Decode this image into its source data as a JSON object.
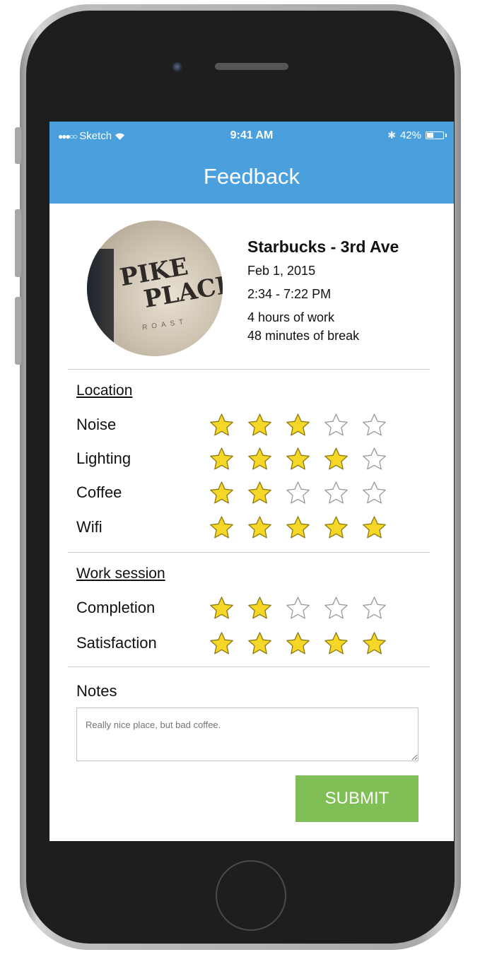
{
  "status_bar": {
    "carrier": "Sketch",
    "time": "9:41 AM",
    "battery": "42%",
    "battery_level": 0.42
  },
  "header": {
    "title": "Feedback"
  },
  "venue": {
    "name": "Starbucks - 3rd Ave",
    "date": "Feb 1, 2015",
    "time_range": "2:34 - 7:22 PM",
    "work_duration": "4 hours of work",
    "break_duration": "48 minutes of break",
    "photo_text": {
      "line1": "PIKE",
      "line2": "PLACE",
      "line3": "ROAST"
    }
  },
  "sections": [
    {
      "title": "Location",
      "ratings": [
        {
          "label": "Noise",
          "value": 3
        },
        {
          "label": "Lighting",
          "value": 4
        },
        {
          "label": "Coffee",
          "value": 2
        },
        {
          "label": "Wifi",
          "value": 5
        }
      ]
    },
    {
      "title": "Work session",
      "ratings": [
        {
          "label": "Completion",
          "value": 2
        },
        {
          "label": "Satisfaction",
          "value": 5
        }
      ]
    }
  ],
  "max_rating": 5,
  "notes": {
    "label": "Notes",
    "placeholder": "Really nice place, but bad coffee."
  },
  "submit_label": "SUBMIT",
  "colors": {
    "header": "#4a9fdd",
    "star_fill": "#f6d626",
    "star_outline": "#9a9a9a",
    "submit": "#80be56"
  }
}
